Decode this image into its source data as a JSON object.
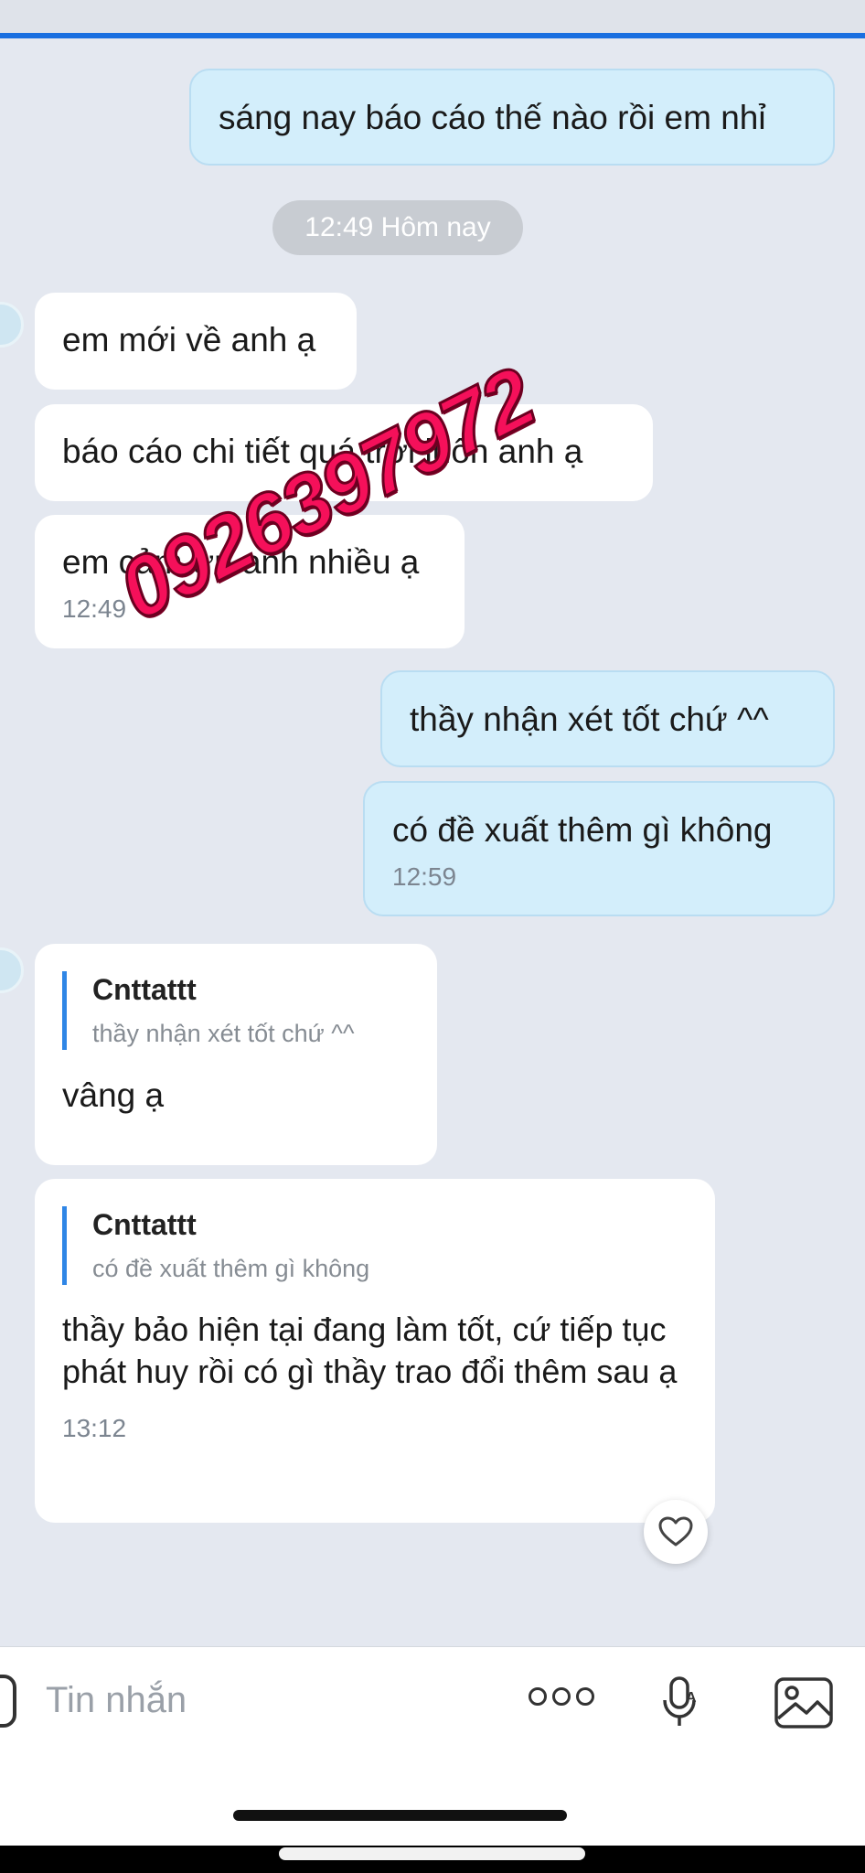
{
  "chat": {
    "messages": [
      {
        "direction": "out",
        "text": "sáng nay báo cáo thế nào rồi em nhỉ"
      },
      {
        "separator": "12:49 Hôm nay"
      },
      {
        "direction": "in",
        "text": "em mới về anh ạ"
      },
      {
        "direction": "in",
        "text": "báo cáo chi tiết quá trời luôn anh ạ"
      },
      {
        "direction": "in",
        "text": "em cảm ơn anh nhiều ạ",
        "time": "12:49"
      },
      {
        "direction": "out",
        "text": "thầy nhận xét tốt chứ ^^"
      },
      {
        "direction": "out",
        "text": "có đề xuất thêm gì không",
        "time": "12:59"
      },
      {
        "direction": "in",
        "quote": {
          "name": "Cnttattt",
          "text": "thầy nhận xét tốt chứ ^^"
        },
        "text": "vâng ạ"
      },
      {
        "direction": "in",
        "quote": {
          "name": "Cnttattt",
          "text": "có đề xuất thêm gì không"
        },
        "text": "thầy bảo hiện tại đang làm tốt, cứ tiếp tục phát huy rồi có gì thầy trao đổi thêm sau ạ",
        "time": "13:12"
      }
    ]
  },
  "watermark": "0926397972",
  "input": {
    "placeholder": "Tin nhắn"
  },
  "icons": [
    "heart-icon",
    "more-icon",
    "mic-icon",
    "gallery-icon"
  ],
  "colors": {
    "outgoing_bubble": "#d3eefb",
    "incoming_bubble": "#ffffff",
    "background": "#e4e8f0",
    "quote_bar": "#2f86e6",
    "watermark": "#f5105a"
  }
}
